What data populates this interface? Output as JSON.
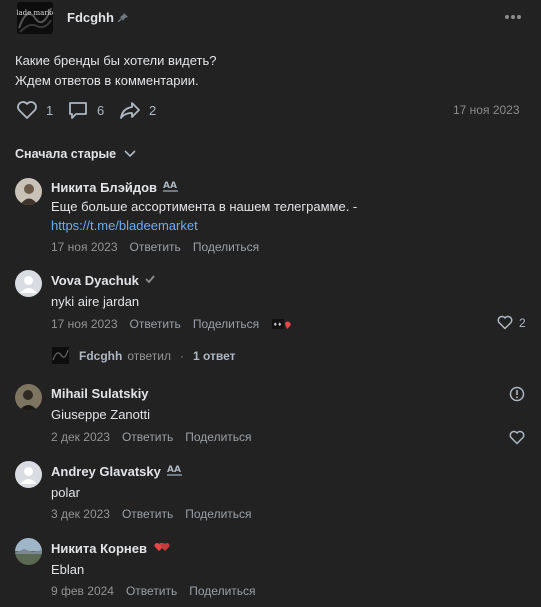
{
  "post": {
    "author": "Fdcghh",
    "avatar_label": "Blade market",
    "text_line1": "Какие бренды бы хотели видеть?",
    "text_line2": "Ждем ответов в комментарии.",
    "likes": "1",
    "comments": "6",
    "shares": "2",
    "date": "17 ноя 2023"
  },
  "sort": {
    "label": "Сначала старые"
  },
  "comments": [
    {
      "name": "Никита Блэйдов",
      "badge": "AA",
      "text": "Еще больше ассортимента в нашем телеграмме. -",
      "link": "https://t.me/bladeemarket",
      "date": "17 ноя 2023",
      "reply": "Ответить",
      "share": "Поделиться"
    },
    {
      "name": "Vova Dyachuk",
      "text": "nyki aire jardan",
      "date": "17 ноя 2023",
      "reply": "Ответить",
      "share": "Поделиться",
      "likes": "2"
    },
    {
      "name": "Mihail Sulatskiy",
      "text": "Giuseppe Zanotti",
      "date": "2 дек 2023",
      "reply": "Ответить",
      "share": "Поделиться"
    },
    {
      "name": "Andrey Glavatsky",
      "badge": "AA",
      "text": "polar",
      "date": "3 дек 2023",
      "reply": "Ответить",
      "share": "Поделиться"
    },
    {
      "name": "Никита Корнев",
      "text": "Eblan",
      "date": "9 фев 2024",
      "reply": "Ответить",
      "share": "Поделиться"
    }
  ],
  "replies": {
    "author": "Fdcghh",
    "verb": "ответил",
    "dot": "·",
    "count": "1 ответ"
  },
  "colors": {
    "background": "#222222",
    "text": "#e1e3e6",
    "muted": "#8c8c8c",
    "link": "#71aaeb"
  },
  "icons": [
    "pin-icon",
    "more-icon",
    "heart-icon",
    "comment-icon",
    "share-icon",
    "chevron-down-icon",
    "verified-icon",
    "report-icon",
    "sticker-icon"
  ]
}
